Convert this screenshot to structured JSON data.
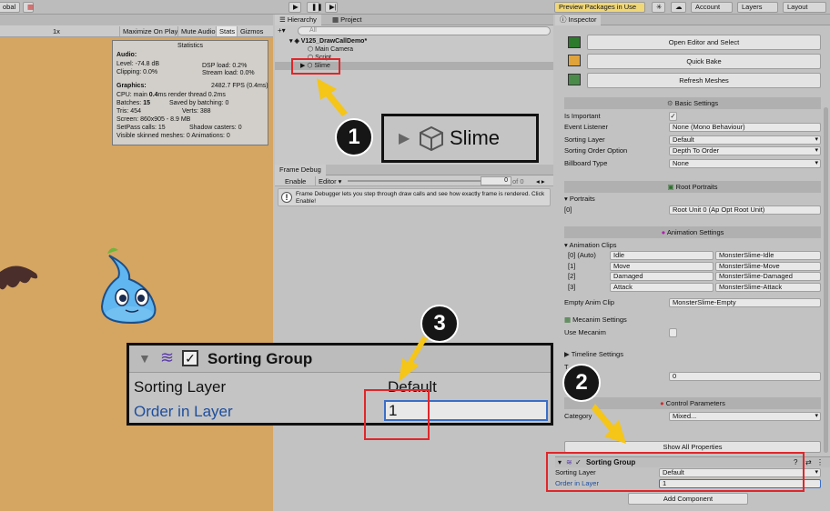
{
  "topbar": {
    "global": "obal",
    "preview": "Preview Packages in Use",
    "account": "Account",
    "layers": "Layers",
    "layout": "Layout"
  },
  "game": {
    "scale": "1x",
    "maximize": "Maximize On Play",
    "mute": "Mute Audio",
    "stats": "Stats",
    "gizmos": "Gizmos"
  },
  "stats": {
    "title": "Statistics",
    "audio": "Audio:",
    "level": "Level: -74.8 dB",
    "dsp": "DSP load: 0.2%",
    "clipping": "Clipping: 0.0%",
    "stream": "Stream load: 0.0%",
    "graphics": "Graphics:",
    "fps": "2482.7 FPS (0.4ms)",
    "cpu_a": "CPU: main ",
    "cpu_b": "0.4",
    "cpu_c": "ms  render thread 0.2ms",
    "batches_a": "Batches: ",
    "batches_b": "15",
    "saved": "Saved by batching: 0",
    "tris": "Tris: 454",
    "verts": "Verts: 388",
    "screen": "Screen: 860x905 - 8.9 MB",
    "setpass": "SetPass calls: 15",
    "shadow": "Shadow casters: 0",
    "skinned": "Visible skinned meshes: 0  Animations: 0"
  },
  "hierarchy": {
    "tab": "Hierarchy",
    "project_tab": "Project",
    "search_placeholder": "All",
    "scene": "V125_DrawCallDemo*",
    "items": [
      "Main Camera",
      "Script",
      "Slime"
    ]
  },
  "frame_debug": {
    "tab": "Frame Debug",
    "enable": "Enable",
    "editor": "Editor",
    "slider_value": "0",
    "of": "of 0",
    "message": "Frame Debugger lets you step through draw calls and see how exactly frame is rendered. Click Enable!"
  },
  "inspector": {
    "tab": "Inspector",
    "buttons": [
      "Open Editor and Select",
      "Quick Bake",
      "Refresh Meshes"
    ],
    "basic_settings": "Basic Settings",
    "is_important": "Is Important",
    "event_listener": "Event Listener",
    "event_listener_value": "None (Mono Behaviour)",
    "sorting_layer": "Sorting Layer",
    "sorting_layer_value": "Default",
    "sorting_order_option": "Sorting Order Option",
    "sorting_order_value": "Depth To Order",
    "billboard_type": "Billboard Type",
    "billboard_value": "None",
    "root_portraits": "Root Portraits",
    "portraits": "Portraits",
    "portrait_index": "[0]",
    "portrait_value": "Root Unit 0 (Ap Opt Root Unit)",
    "animation_settings": "Animation Settings",
    "animation_clips": "Animation Clips",
    "clips": [
      {
        "idx": "[0] (Auto)",
        "name": "Idle",
        "ref": "MonsterSlime-Idle"
      },
      {
        "idx": "[1]",
        "name": "Move",
        "ref": "MonsterSlime-Move"
      },
      {
        "idx": "[2]",
        "name": "Damaged",
        "ref": "MonsterSlime-Damaged"
      },
      {
        "idx": "[3]",
        "name": "Attack",
        "ref": "MonsterSlime-Attack"
      }
    ],
    "empty_anim_clip": "Empty Anim Clip",
    "empty_anim_value": "MonsterSlime-Empty",
    "mecanim_settings": "Mecanim Settings",
    "use_mecanim": "Use Mecanim",
    "timeline_settings": "Timeline Settings",
    "timeline_row": "T",
    "timeline_value": "0",
    "control_parameters": "Control Parameters",
    "category": "Category",
    "category_value": "Mixed...",
    "show_all": "Show All Properties",
    "sorting_group": "Sorting Group",
    "sg_layer": "Sorting Layer",
    "sg_layer_value": "Default",
    "sg_order": "Order in Layer",
    "sg_order_value": "1",
    "add_component": "Add Component"
  },
  "callouts": {
    "n1": "1",
    "n2": "2",
    "n3": "3",
    "zoom1_label": "Slime",
    "zoom3_title": "Sorting Group",
    "zoom3_layer": "Sorting Layer",
    "zoom3_layer_value": "Default",
    "zoom3_order": "Order in Layer",
    "zoom3_order_value": "1"
  },
  "colors": {
    "accent_red": "#e0262a",
    "arrow_yellow": "#f5c518",
    "link_blue": "#1d4e9e",
    "game_bg": "#d5a562"
  }
}
